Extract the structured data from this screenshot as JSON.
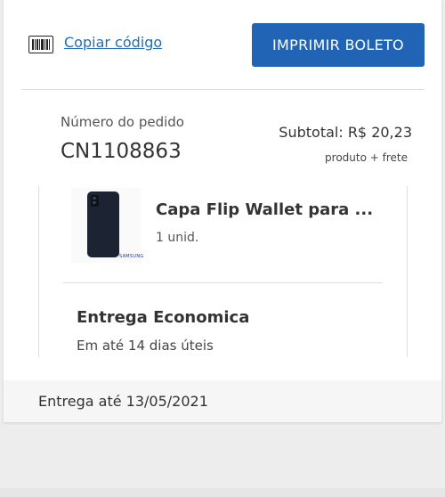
{
  "actions": {
    "copy_code_label": "Copiar código",
    "print_button_label": "IMPRIMIR BOLETO"
  },
  "order": {
    "number_label": "Número do pedido",
    "number": "CN1108863",
    "subtotal": "Subtotal: R$ 20,23",
    "subtotal_note": "produto + frete"
  },
  "item": {
    "name": "Capa Flip Wallet para ...",
    "quantity": "1 unid.",
    "image_icon": "phone-case-image",
    "brand_mark": "SAMSUNG"
  },
  "delivery": {
    "title": "Entrega Economica",
    "eta": "Em até 14 dias úteis",
    "date": "Entrega até 13/05/2021"
  },
  "colors": {
    "accent": "#2163b5",
    "link": "#1f6eb7",
    "background": "#ededed"
  }
}
